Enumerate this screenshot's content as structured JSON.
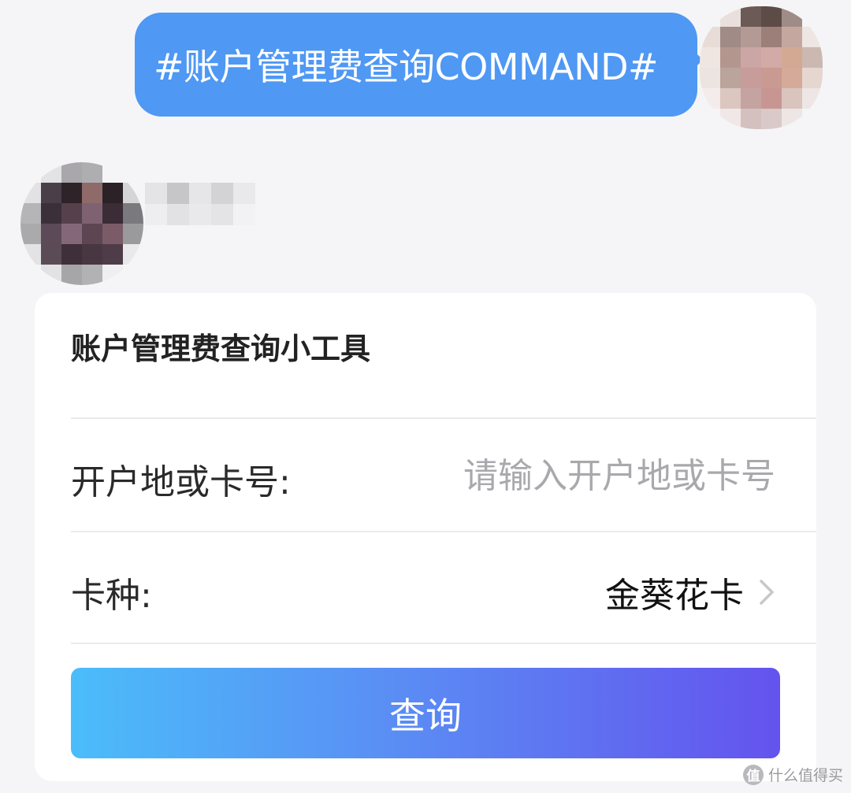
{
  "user_message": {
    "text": "#账户管理费查询COMMAND#"
  },
  "card": {
    "title": "账户管理费查询小工具",
    "location_field": {
      "label": "开户地或卡号:",
      "value": "",
      "placeholder": "请输入开户地或卡号"
    },
    "card_type_field": {
      "label": "卡种:",
      "selected": "金葵花卡"
    },
    "query_button": "查询"
  },
  "watermark": {
    "text": "什么值得买",
    "icon_glyph": "值"
  },
  "colors": {
    "user_bubble": "#4f98f4",
    "button_gradient_start": "#4bbdfa",
    "button_gradient_end": "#6453ee",
    "page_background": "#f5f5f7"
  }
}
